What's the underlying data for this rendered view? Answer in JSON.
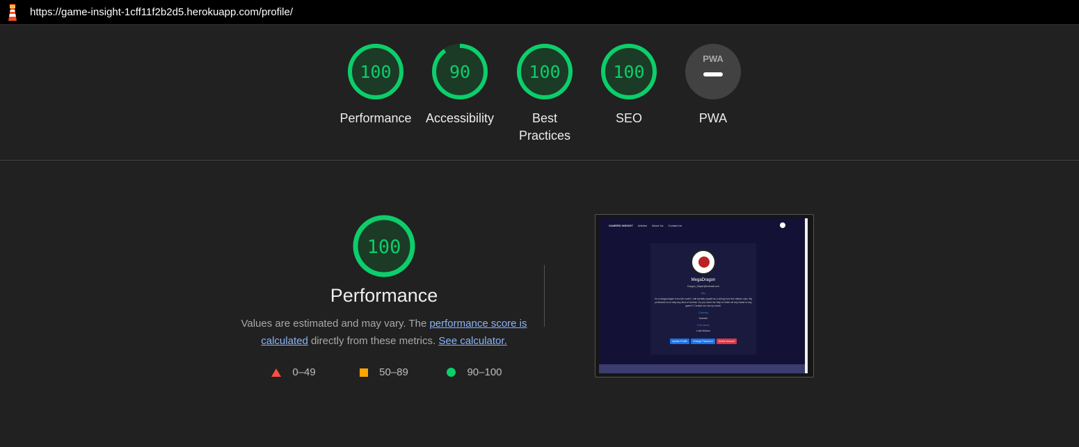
{
  "browser": {
    "url": "https://game-insight-1cff11f2b2d5.herokuapp.com/profile/"
  },
  "categories": [
    {
      "label": "Performance",
      "score": "100",
      "fraction": 1.0,
      "color": "#0cce6b"
    },
    {
      "label": "Accessibility",
      "score": "90",
      "fraction": 0.9,
      "color": "#0cce6b"
    },
    {
      "label": "Best Practices",
      "score": "100",
      "fraction": 1.0,
      "color": "#0cce6b"
    },
    {
      "label": "SEO",
      "score": "100",
      "fraction": 1.0,
      "color": "#0cce6b"
    },
    {
      "label": "PWA",
      "badge": "PWA",
      "icon": "pwa-dash-icon"
    }
  ],
  "performance": {
    "score": "100",
    "title": "Performance",
    "desc_prefix": "Values are estimated and may vary. The ",
    "link_score": "performance score is calculated",
    "desc_middle": " directly from these metrics. ",
    "link_calc": "See calculator.",
    "legend": [
      {
        "range": "0–49",
        "color": "#ff4e42",
        "icon": "triangle-icon"
      },
      {
        "range": "50–89",
        "color": "#ffa400",
        "icon": "square-icon"
      },
      {
        "range": "90–100",
        "color": "#0cce6b",
        "icon": "circle-icon"
      }
    ]
  },
  "screenshot": {
    "brand": "GAMERS INSIGHT",
    "nav": [
      "Articles",
      "About Us",
      "Contact Us"
    ],
    "username": "MegaDragon",
    "email": "Dragon_Slayer@hotmail.com",
    "bio_heading": "Bio",
    "bio_text": "I'm a dragonslayer from the north! I will identify myself as a viking from the Valerni clan. My profession is to slay any kind of animal. Do you want me help to finish off any beast in any game? Contact me via my email.",
    "country_heading": "Country",
    "country": "Sweden",
    "fullname_heading": "Full name",
    "fullname": "Lotta Nilsson",
    "buttons": [
      "Update Profile",
      "Change Password",
      "Delete Account"
    ]
  },
  "colors": {
    "pass": "#0cce6b",
    "background": "#212121"
  }
}
